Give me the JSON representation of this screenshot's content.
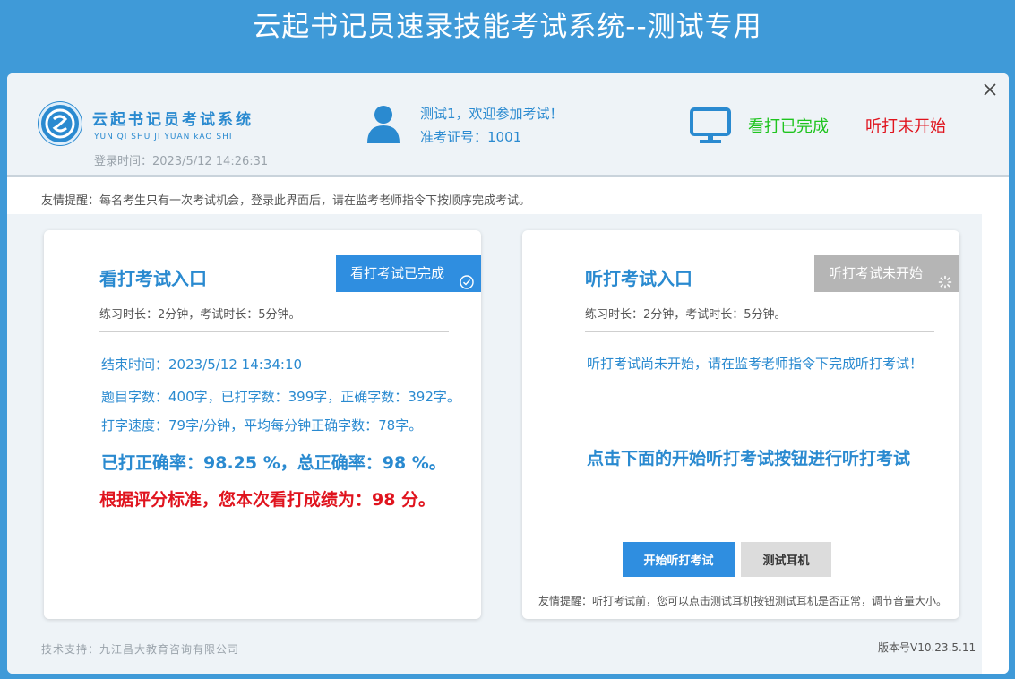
{
  "app_title": "云起书记员速录技能考试系统--测试专用",
  "header": {
    "logo_title": "云起书记员考试系统",
    "logo_subtitle": "YUN QI SHU JI YUAN kAO SHI",
    "login_time": "登录时间：2023/5/12 14:26:31",
    "welcome": "测试1，欢迎参加考试！",
    "ticket": "准考证号：1001",
    "status_view": "看打已完成",
    "status_listen": "听打未开始",
    "icons": [
      "logo-icon",
      "user-icon",
      "monitor-icon",
      "close-icon"
    ]
  },
  "tip": "友情提醒：每名考生只有一次考试机会，登录此界面后，请在监考老师指令下按顺序完成考试。",
  "left_card": {
    "title": "看打考试入口",
    "badge": "看打考试已完成",
    "duration": "练习时长：2分钟，考试时长：5分钟。",
    "end_time": "结束时间：2023/5/12 14:34:10",
    "words": "题目字数：400字，已打字数：399字，正确字数：392字。",
    "speed": "打字速度：79字/分钟，平均每分钟正确字数：78字。",
    "accuracy": "已打正确率：98.25 %，总正确率：98 %。",
    "score": "根据评分标准，您本次看打成绩为：98 分。"
  },
  "right_card": {
    "title": "听打考试入口",
    "badge": "听打考试未开始",
    "duration": "练习时长：2分钟，考试时长：5分钟。",
    "message": "听打考试尚未开始，请在监考老师指令下完成听打考试！",
    "cta": "点击下面的开始听打考试按钮进行听打考试",
    "start_button": "开始听打考试",
    "test_button": "测试耳机",
    "tip": "友情提醒：听打考试前，您可以点击测试耳机按钮测试耳机是否正常，调节音量大小。"
  },
  "footer": {
    "support": "技术支持：九江昌大教育咨询有限公司",
    "version": "版本号V10.23.5.11"
  },
  "colors": {
    "background": "#3f9ad8",
    "accent": "#2a8ad0",
    "button_blue": "#2f8ee0",
    "success": "#1fc41f",
    "danger": "#e0141e"
  }
}
